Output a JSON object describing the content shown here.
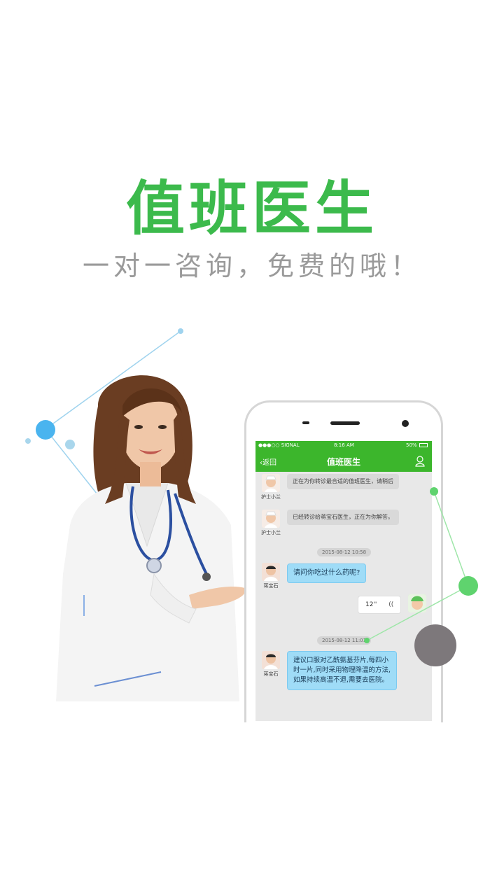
{
  "headline": "值班医生",
  "tagline": "一对一咨询，免费的哦！",
  "colors": {
    "brand_green": "#3cba4c",
    "nav_green": "#3cb62c",
    "bubble_blue": "#9fdcf7",
    "accent_blue": "#4ab4ef",
    "accent_gray": "#7d787b"
  },
  "phone": {
    "status": {
      "carrier": "●●●○○ SIGNAL",
      "time": "8:16 AM",
      "battery": "50%"
    },
    "nav": {
      "back_label": "返回",
      "title": "值班医生",
      "user_icon": "person-icon"
    },
    "messages": [
      {
        "sender": "护士小兰",
        "text": "正在为你转诊最合适的值班医生，请稍后"
      },
      {
        "sender": "护士小兰",
        "text": "已经转诊给蒋宝石医生，正在为你解答。"
      },
      {
        "timestamp": "2015-08-12 10:58"
      },
      {
        "sender": "蒋宝石",
        "text": "请问你吃过什么药呢?"
      },
      {
        "self_voice": "12''"
      },
      {
        "timestamp": "2015-08-12 11:01"
      },
      {
        "sender": "蒋宝石",
        "text_lines": [
          "建议口服对乙酰氨基芬片,每四小",
          "时一片,同时采用物理降温的方法,",
          "如果持续高温不退,需要去医院。"
        ]
      }
    ]
  }
}
